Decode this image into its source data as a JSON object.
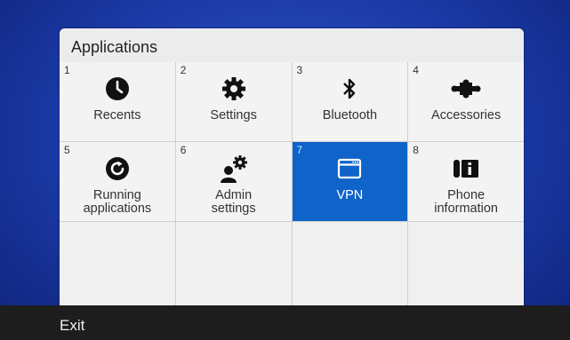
{
  "panel": {
    "title": "Applications"
  },
  "apps": [
    {
      "number": "1",
      "label": "Recents",
      "icon": "clock-icon",
      "selected": false
    },
    {
      "number": "2",
      "label": "Settings",
      "icon": "gear-icon",
      "selected": false
    },
    {
      "number": "3",
      "label": "Bluetooth",
      "icon": "bluetooth-icon",
      "selected": false
    },
    {
      "number": "4",
      "label": "Accessories",
      "icon": "puzzle-icon",
      "selected": false
    },
    {
      "number": "5",
      "label": "Running applications",
      "icon": "running-apps-icon",
      "selected": false
    },
    {
      "number": "6",
      "label": "Admin settings",
      "icon": "admin-settings-icon",
      "selected": false
    },
    {
      "number": "7",
      "label": "VPN",
      "icon": "window-icon",
      "selected": true
    },
    {
      "number": "8",
      "label": "Phone information",
      "icon": "phone-info-icon",
      "selected": false
    }
  ],
  "footer": {
    "exit_label": "Exit"
  },
  "colors": {
    "selected_tile": "#0f63c9",
    "background": "#1b3aa6",
    "footer": "#1d1d1d"
  }
}
